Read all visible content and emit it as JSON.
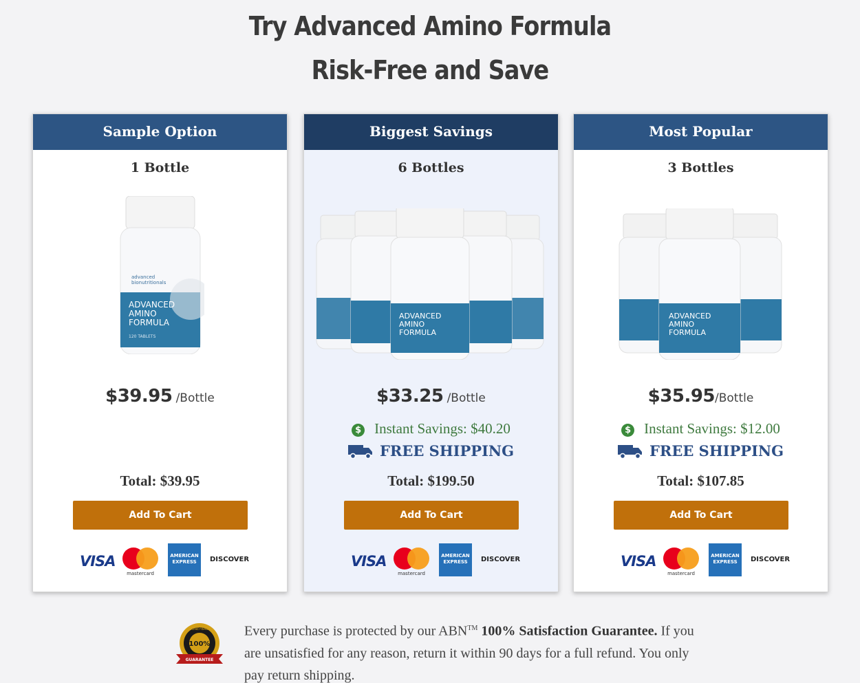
{
  "heading": {
    "line1": "Try Advanced Amino Formula",
    "line2": "Risk-Free and Save"
  },
  "product": {
    "brand_line1": "advanced",
    "brand_line2": "bionutritionals",
    "name_line1": "ADVANCED",
    "name_line2": "AMINO",
    "name_line3": "FORMULA",
    "count": "120 TABLETS"
  },
  "colors": {
    "header": "#2d5584",
    "header_highlight": "#1f3d63",
    "cart_button": "#c0700b",
    "savings": "#3f7a3f",
    "shipping": "#2d4f86"
  },
  "cards": [
    {
      "header": "Sample Option",
      "bottles": "1 Bottle",
      "price": "$39.95",
      "unit": "/Bottle",
      "savings": "",
      "shipping": "",
      "total": "Total: $39.95",
      "button": "Add To Cart"
    },
    {
      "header": "Biggest Savings",
      "bottles": "6 Bottles",
      "price": "$33.25",
      "unit": "/Bottle",
      "savings": "Instant Savings: $40.20",
      "shipping": "FREE SHIPPING",
      "total": "Total: $199.50",
      "button": "Add To Cart"
    },
    {
      "header": "Most Popular",
      "bottles": "3 Bottles",
      "price": "$35.95",
      "unit": "/Bottle",
      "savings": "Instant Savings: $12.00",
      "shipping": "FREE SHIPPING",
      "total": "Total: $107.85",
      "button": "Add To Cart"
    }
  ],
  "payments": {
    "visa": "VISA",
    "mastercard": "mastercard",
    "amex_line1": "AMERICAN",
    "amex_line2": "EXPRESS",
    "discover": "DISCOVER"
  },
  "guarantee": {
    "badge_top": "MONEYBACK",
    "badge_pct": "100%",
    "badge_bottom": "GUARANTEE",
    "text_part1": "Every purchase is protected by our ABN",
    "tm": "TM",
    "text_bold": "100% Satisfaction Guarantee.",
    "text_part2": "If you are unsatisfied for any reason, return it within 90 days for a full refund. You only pay return shipping."
  }
}
